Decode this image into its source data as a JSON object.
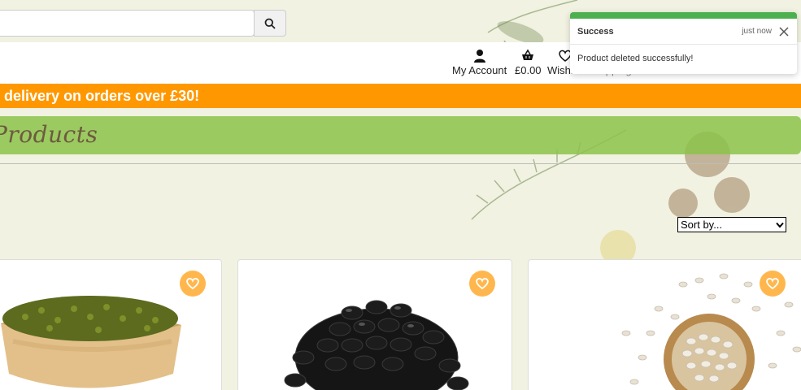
{
  "search": {
    "placeholder": ""
  },
  "nav": {
    "account_label": "My Account",
    "basket_total": "£0.00",
    "wishlist_label": "Wishlist",
    "shipping_label": "Shipping Info"
  },
  "banner": {
    "strong": "delivery",
    "rest": "on orders over £30!"
  },
  "page_title": "Products",
  "sort": {
    "selected": "Sort by..."
  },
  "toast": {
    "title": "Success",
    "time": "just now",
    "message": "Product deleted successfully!"
  },
  "colors": {
    "banner": "#ff9800",
    "title_bar": "#8cc34a",
    "toast_accent": "#4caf50",
    "fav_button": "#ffb74d"
  },
  "icons": [
    "search-icon",
    "user-icon",
    "basket-icon",
    "heart-icon",
    "truck-icon",
    "close-icon",
    "chevron-down-icon"
  ]
}
